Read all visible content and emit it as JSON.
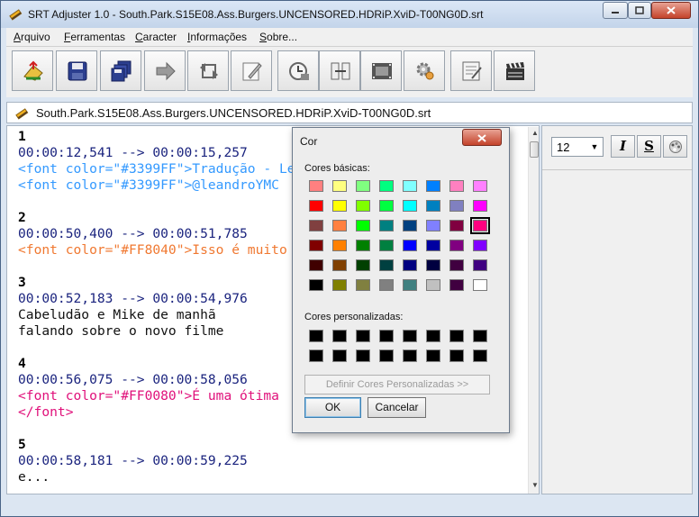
{
  "window": {
    "title": "SRT Adjuster 1.0 - South.Park.S15E08.Ass.Burgers.UNCENSORED.HDRiP.XviD-T00NG0D.srt",
    "controls": [
      "minimize-icon",
      "maximize-icon",
      "close-icon"
    ]
  },
  "menu": [
    {
      "label": "Arquivo",
      "key": "A",
      "rest": "rquivo"
    },
    {
      "label": "Ferramentas",
      "key": "F",
      "rest": "erramentas"
    },
    {
      "label": "Caracter",
      "key": "C",
      "rest": "aracter"
    },
    {
      "label": "Informações",
      "key": "I",
      "rest": "nformações"
    },
    {
      "label": "Sobre...",
      "key": "S",
      "rest": "obre..."
    }
  ],
  "toolbar": {
    "buttons": [
      "open-icon",
      "save-icon",
      "save-all-icon",
      "forward-arrow-icon",
      "sync-icon",
      "edit-icon",
      "clock-icon",
      "split-icon",
      "film-icon",
      "settings-icon",
      "notepad-icon",
      "clapperboard-icon"
    ]
  },
  "file": {
    "name": "South.Park.S15E08.Ass.Burgers.UNCENSORED.HDRiP.XviD-T00NG0D.srt"
  },
  "editor": {
    "lines": [
      {
        "text": "1",
        "style": "num"
      },
      {
        "text": "00:00:12,541 --> 00:00:15,257",
        "style": "time"
      },
      {
        "text": "<font color=\"#3399FF\">Tradução - Le",
        "style": "blue"
      },
      {
        "text": "<font color=\"#3399FF\">@leandroYMC",
        "style": "blue"
      },
      {
        "text": "",
        "style": "blank"
      },
      {
        "text": "2",
        "style": "num"
      },
      {
        "text": "00:00:50,400 --> 00:00:51,785",
        "style": "time"
      },
      {
        "text": "<font color=\"#FF8040\">Isso é muito",
        "style": "orange"
      },
      {
        "text": "",
        "style": "blank"
      },
      {
        "text": "3",
        "style": "num"
      },
      {
        "text": "00:00:52,183 --> 00:00:54,976",
        "style": "time"
      },
      {
        "text": "Cabeludão e Mike de manhã",
        "style": "plain"
      },
      {
        "text": "falando sobre o novo filme",
        "style": "plain"
      },
      {
        "text": "",
        "style": "blank"
      },
      {
        "text": "4",
        "style": "num"
      },
      {
        "text": "00:00:56,075 --> 00:00:58,056",
        "style": "time"
      },
      {
        "text": "<font color=\"#FF0080\">É uma ótima",
        "style": "pink"
      },
      {
        "text": "</font>",
        "style": "pink"
      },
      {
        "text": "",
        "style": "blank"
      },
      {
        "text": "5",
        "style": "num"
      },
      {
        "text": "00:00:58,181 --> 00:00:59,225",
        "style": "time"
      },
      {
        "text": "e...",
        "style": "plain"
      }
    ]
  },
  "format_panel": {
    "font_size": "12",
    "italic_label": "I",
    "strike_label": "S"
  },
  "color_dialog": {
    "title": "Cor",
    "basic_label": "Cores básicas:",
    "custom_label": "Cores personalizadas:",
    "define_custom_label": "Definir Cores Personalizadas >>",
    "ok_label": "OK",
    "cancel_label": "Cancelar",
    "selected_index": 23,
    "basic_colors": [
      "#ff8080",
      "#ffff80",
      "#80ff80",
      "#00ff80",
      "#80ffff",
      "#0080ff",
      "#ff80c0",
      "#ff80ff",
      "#ff0000",
      "#ffff00",
      "#80ff00",
      "#00ff40",
      "#00ffff",
      "#0080c0",
      "#8080c0",
      "#ff00ff",
      "#804040",
      "#ff8040",
      "#00ff00",
      "#008080",
      "#004080",
      "#8080ff",
      "#800040",
      "#ff0080",
      "#800000",
      "#ff8000",
      "#008000",
      "#008040",
      "#0000ff",
      "#0000a0",
      "#800080",
      "#8000ff",
      "#400000",
      "#804000",
      "#004000",
      "#004040",
      "#000080",
      "#000040",
      "#400040",
      "#400080",
      "#000000",
      "#808000",
      "#808040",
      "#808080",
      "#408080",
      "#c0c0c0",
      "#400040",
      "#ffffff"
    ],
    "custom_colors": [
      "#000000",
      "#000000",
      "#000000",
      "#000000",
      "#000000",
      "#000000",
      "#000000",
      "#000000",
      "#000000",
      "#000000",
      "#000000",
      "#000000",
      "#000000",
      "#000000",
      "#000000",
      "#000000"
    ]
  }
}
